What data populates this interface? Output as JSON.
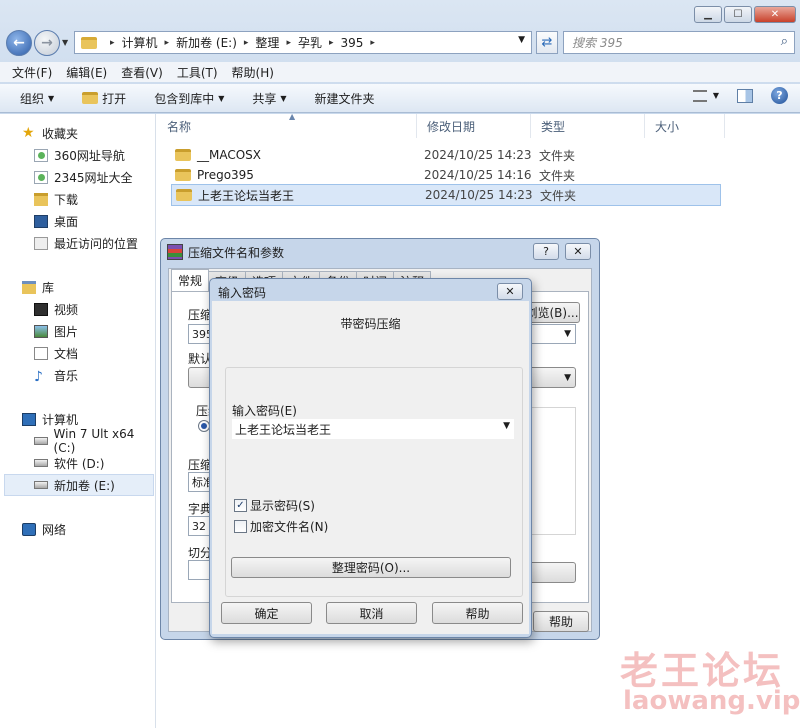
{
  "window": {
    "address_crumbs": [
      "计算机",
      "新加卷 (E:)",
      "整理",
      "孕乳",
      "395"
    ],
    "search_placeholder": "搜索 395"
  },
  "menu": [
    "文件(F)",
    "编辑(E)",
    "查看(V)",
    "工具(T)",
    "帮助(H)"
  ],
  "toolbar": {
    "organize": "组织",
    "open": "打开",
    "include_library": "包含到库中",
    "share": "共享",
    "new_folder": "新建文件夹"
  },
  "nav": {
    "favorites": "收藏夹",
    "fav_items": [
      "360网址导航",
      "2345网址大全",
      "下载",
      "桌面",
      "最近访问的位置"
    ],
    "libraries": "库",
    "lib_items": [
      "视频",
      "图片",
      "文档",
      "音乐"
    ],
    "computer": "计算机",
    "drives": [
      "Win 7 Ult x64 (C:)",
      "软件 (D:)",
      "新加卷 (E:)"
    ],
    "network": "网络"
  },
  "columns": [
    "名称",
    "修改日期",
    "类型",
    "大小"
  ],
  "files": [
    {
      "name": "__MACOSX",
      "date": "2024/10/25 14:23",
      "type": "文件夹"
    },
    {
      "name": "Prego395",
      "date": "2024/10/25 14:16",
      "type": "文件夹"
    },
    {
      "name": "上老王论坛当老王",
      "date": "2024/10/25 14:23",
      "type": "文件夹"
    }
  ],
  "rar_dialog": {
    "title": "压缩文件名和参数",
    "tabs": [
      "常规",
      "高级",
      "选项",
      "文件",
      "备份",
      "时间",
      "注释"
    ],
    "label_archive": "压缩",
    "archive_value": "395.",
    "browse_btn": "浏览(B)...",
    "label_default": "默认",
    "label_format": "压缩",
    "label_method": "压缩",
    "method_value": "标准",
    "label_dict": "字典",
    "dict_value": "32 M",
    "label_split": "切分",
    "help": "帮助"
  },
  "password_dialog": {
    "title": "输入密码",
    "heading": "带密码压缩",
    "enter_label": "输入密码(E)",
    "password_value": "上老王论坛当老王",
    "show_password": "显示密码(S)",
    "encrypt_names": "加密文件名(N)",
    "organize": "整理密码(O)...",
    "ok": "确定",
    "cancel": "取消",
    "help": "帮助"
  },
  "watermark": {
    "cn": "老王论坛",
    "url": "laowang.vip"
  },
  "colors": {
    "selection": "#d9e7f8",
    "dialog_frame": "#c6d6ea",
    "watermark": "#e15a5a"
  }
}
